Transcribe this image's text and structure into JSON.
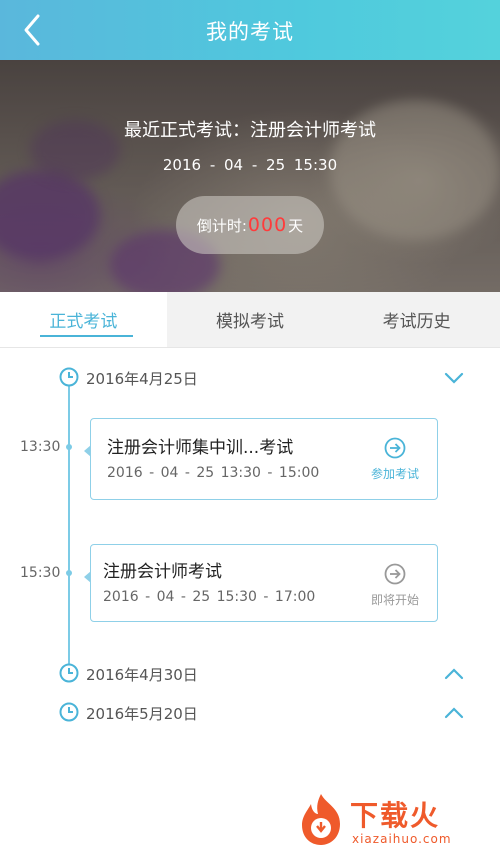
{
  "header": {
    "title": "我的考试"
  },
  "hero": {
    "title": "最近正式考试：注册会计师考试",
    "datetime": "2016 - 04 - 25   15:30",
    "countdown_label": "倒计时:",
    "countdown_value": "000",
    "countdown_unit": "天"
  },
  "tabs": [
    {
      "label": "正式考试"
    },
    {
      "label": "模拟考试"
    },
    {
      "label": "考试历史"
    }
  ],
  "timeline": {
    "groups": [
      {
        "date": "2016年4月25日"
      },
      {
        "date": "2016年4月30日"
      },
      {
        "date": "2016年5月20日"
      }
    ],
    "exams": [
      {
        "time": "13:30",
        "title": "注册会计师集中训...考试",
        "schedule": "2016 - 04 - 25   13:30 - 15:00",
        "action": "参加考试",
        "action_color": "#4ab4d8"
      },
      {
        "time": "15:30",
        "title": "注册会计师考试",
        "schedule": "2016 - 04 - 25   15:30 - 17:00",
        "action": "即将开始",
        "action_color": "#999999"
      }
    ]
  },
  "watermark": {
    "text": "下载火",
    "url": "xiazaihuo.com"
  },
  "colors": {
    "accent": "#4ab4d8",
    "countdown": "#ff3b3b",
    "watermark": "#ef5a2b"
  }
}
